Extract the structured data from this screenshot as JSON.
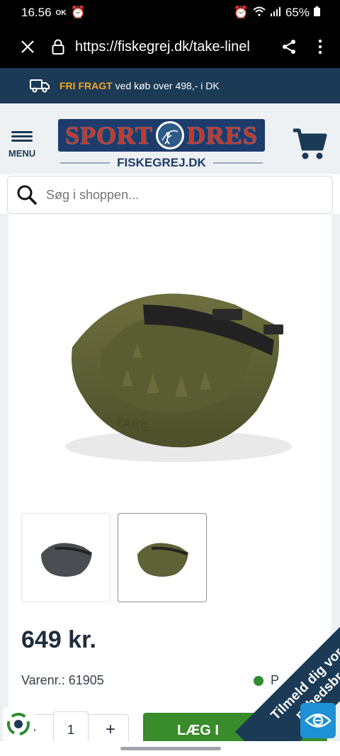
{
  "status_bar": {
    "time": "16.56",
    "ok_badge": "OK",
    "battery": "65%"
  },
  "browser": {
    "url": "https://fiskegrej.dk/take-linel"
  },
  "shipping_banner": {
    "highlight": "FRI FRAGT",
    "text": "ved køb over 498,- i DK"
  },
  "header": {
    "menu_label": "MENU",
    "logo_left": "SPORT",
    "logo_right": "DRES",
    "logo_sub": "FISKEGREJ.DK"
  },
  "search": {
    "placeholder": "Søg i shoppen..."
  },
  "product": {
    "price": "649 kr.",
    "sku_label": "Varenr.:",
    "sku": "61905",
    "stock_text": "P",
    "quantity": "1",
    "qty_minus": "-",
    "qty_plus": "+",
    "add_to_cart": "LÆG I"
  },
  "newsletter_ribbon": {
    "line1": "Tilmeld dig vores",
    "line2": "nyhedsbrev"
  },
  "colors": {
    "brand_navy": "#1b3a56",
    "accent_orange": "#f5a623",
    "add_green": "#3a8b2b",
    "stock_green": "#2e8b2e",
    "product_olive": "#5f6136"
  }
}
